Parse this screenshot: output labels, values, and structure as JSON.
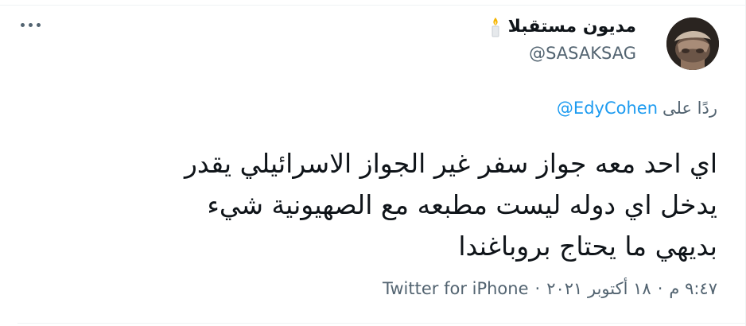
{
  "tweet": {
    "author": {
      "display_name": "مديون مستقبلا",
      "handle": "@SASAKSAG",
      "avatar_icon": "avatar-photo",
      "badge_icon": "candle-icon"
    },
    "more_icon": "more-icon",
    "reply": {
      "prefix": "ردًا على",
      "mention": "@EdyCohen"
    },
    "text_lines": [
      "اي احد معه جواز سفر غير الجواز الاسرائيلي يقدر",
      "يدخل اي دوله ليست مطبعه مع الصهيونية شيء",
      "بديهي ما يحتاج بروباغندا"
    ],
    "meta": {
      "time": "٩:٤٧ م",
      "separator": "·",
      "date": "١٨ أكتوبر ٢٠٢١",
      "source": "Twitter for iPhone"
    },
    "colors": {
      "text": "#0f1419",
      "secondary": "#536471",
      "link": "#1d9bf0",
      "divider": "#eff3f4"
    }
  }
}
